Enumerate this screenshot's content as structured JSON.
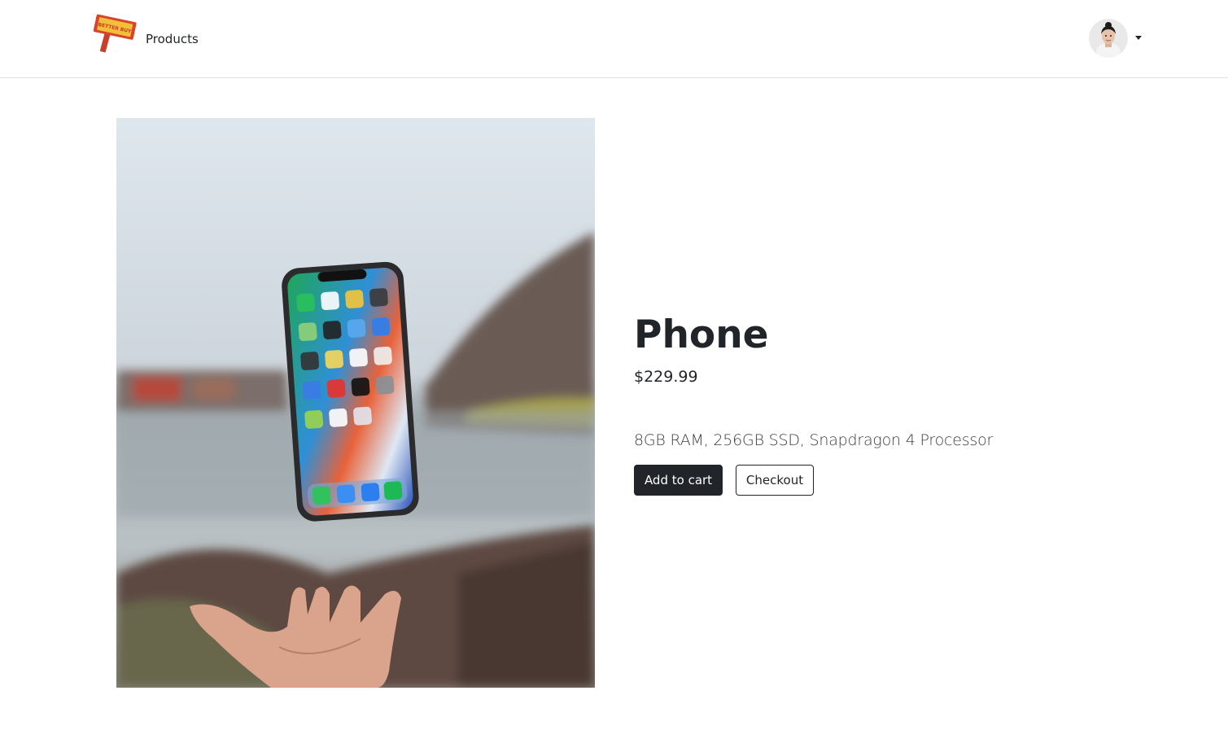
{
  "nav": {
    "brand_icon": "better-buy-logo",
    "products_label": "Products",
    "avatar_icon": "user-avatar",
    "dropdown_icon": "caret-down-icon"
  },
  "product": {
    "title": "Phone",
    "price": "$229.99",
    "description": "8GB RAM, 256GB SSD, Snapdragon 4 Processor",
    "image_icon": "phone-photo"
  },
  "actions": {
    "add_to_cart_label": "Add to cart",
    "checkout_label": "Checkout"
  },
  "colors": {
    "dark": "#212529",
    "border": "#dee2e6",
    "logo_red": "#d9432c",
    "logo_yellow": "#f2c038"
  }
}
